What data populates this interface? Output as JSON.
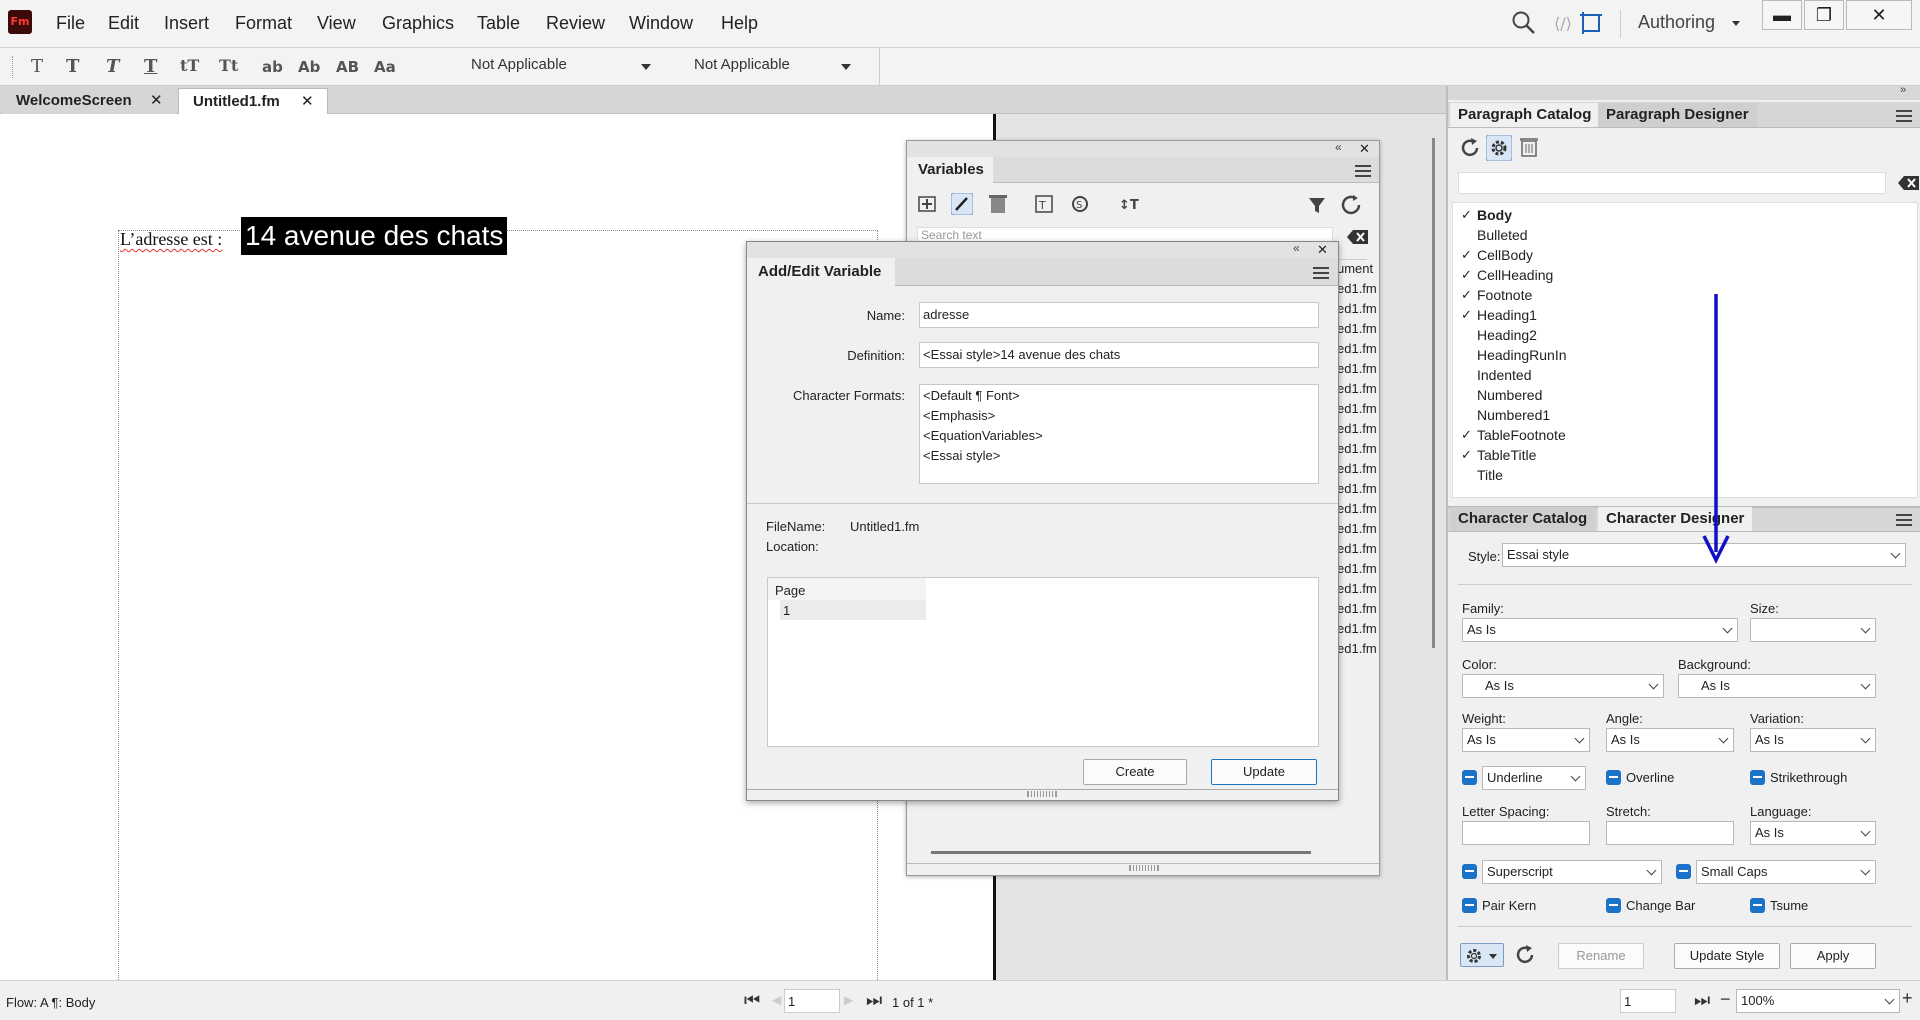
{
  "app": {
    "logo_text": "Fm",
    "mode": "Authoring"
  },
  "menu": [
    "File",
    "Edit",
    "Insert",
    "Format",
    "View",
    "Graphics",
    "Table",
    "Review",
    "Window",
    "Help"
  ],
  "toolbar": {
    "style_buttons": [
      "T",
      "T",
      "T",
      "T",
      "tT",
      "Tt",
      "ab",
      "Ab",
      "AB",
      "Aa"
    ],
    "select1": "Not Applicable",
    "select2": "Not Applicable"
  },
  "tabs": [
    {
      "label": "WelcomeScreen",
      "close": "✕"
    },
    {
      "label": "Untitled1.fm",
      "close": "✕"
    }
  ],
  "document": {
    "body_text": "L’adresse est : ",
    "variable_text": "14 avenue des chats"
  },
  "variables_panel": {
    "title": "Variables",
    "search_placeholder": "Search text",
    "column_header": "ument",
    "row_text": "ed1.fm",
    "row_count": 19
  },
  "add_edit": {
    "title": "Add/Edit Variable",
    "name_label": "Name:",
    "name_value": "adresse",
    "definition_label": "Definition:",
    "definition_value": "<Essai style>14 avenue des chats",
    "char_formats_label": "Character Formats:",
    "char_formats": [
      "<Default ¶ Font>",
      "<Emphasis>",
      "<EquationVariables>",
      "<Essai style>"
    ],
    "filename_label": "FileName:",
    "filename_value": "Untitled1.fm",
    "location_label": "Location:",
    "page_header": "Page",
    "page_value": "1",
    "create_label": "Create",
    "update_label": "Update"
  },
  "paragraph_catalog": {
    "tab1": "Paragraph Catalog",
    "tab2": "Paragraph Designer",
    "items": [
      {
        "label": "Body",
        "checked": true,
        "bold": true
      },
      {
        "label": "Bulleted",
        "checked": false
      },
      {
        "label": "CellBody",
        "checked": true
      },
      {
        "label": "CellHeading",
        "checked": true
      },
      {
        "label": "Footnote",
        "checked": true
      },
      {
        "label": "Heading1",
        "checked": true
      },
      {
        "label": "Heading2",
        "checked": false
      },
      {
        "label": "HeadingRunIn",
        "checked": false
      },
      {
        "label": "Indented",
        "checked": false
      },
      {
        "label": "Numbered",
        "checked": false
      },
      {
        "label": "Numbered1",
        "checked": false
      },
      {
        "label": "TableFootnote",
        "checked": true
      },
      {
        "label": "TableTitle",
        "checked": true
      },
      {
        "label": "Title",
        "checked": false
      }
    ],
    "check_glyph": "✓"
  },
  "char_designer": {
    "tab1": "Character Catalog",
    "tab2": "Character Designer",
    "style_label": "Style:",
    "style_value": "Essai style",
    "family_label": "Family:",
    "family_value": "As Is",
    "size_label": "Size:",
    "size_value": "",
    "color_label": "Color:",
    "color_value": "As Is",
    "background_label": "Background:",
    "background_value": "As Is",
    "weight_label": "Weight:",
    "weight_value": "As Is",
    "angle_label": "Angle:",
    "angle_value": "As Is",
    "variation_label": "Variation:",
    "variation_value": "As Is",
    "underline_value": "Underline",
    "overline_label": "Overline",
    "strikethrough_label": "Strikethrough",
    "letter_spacing_label": "Letter Spacing:",
    "stretch_label": "Stretch:",
    "language_label": "Language:",
    "language_value": "As Is",
    "superscript_value": "Superscript",
    "smallcaps_value": "Small Caps",
    "pairkern_label": "Pair Kern",
    "changebar_label": "Change Bar",
    "tsume_label": "Tsume",
    "rename_label": "Rename",
    "update_style_label": "Update Style",
    "apply_label": "Apply"
  },
  "statusbar": {
    "flow": "Flow: A  ¶: Body",
    "page_input": "1",
    "page_of": "1 of 1 *",
    "zoom_page": "1",
    "zoom": "100%"
  },
  "colors": {
    "accent": "#1a73c8",
    "annotation_arrow": "#1010c8"
  }
}
